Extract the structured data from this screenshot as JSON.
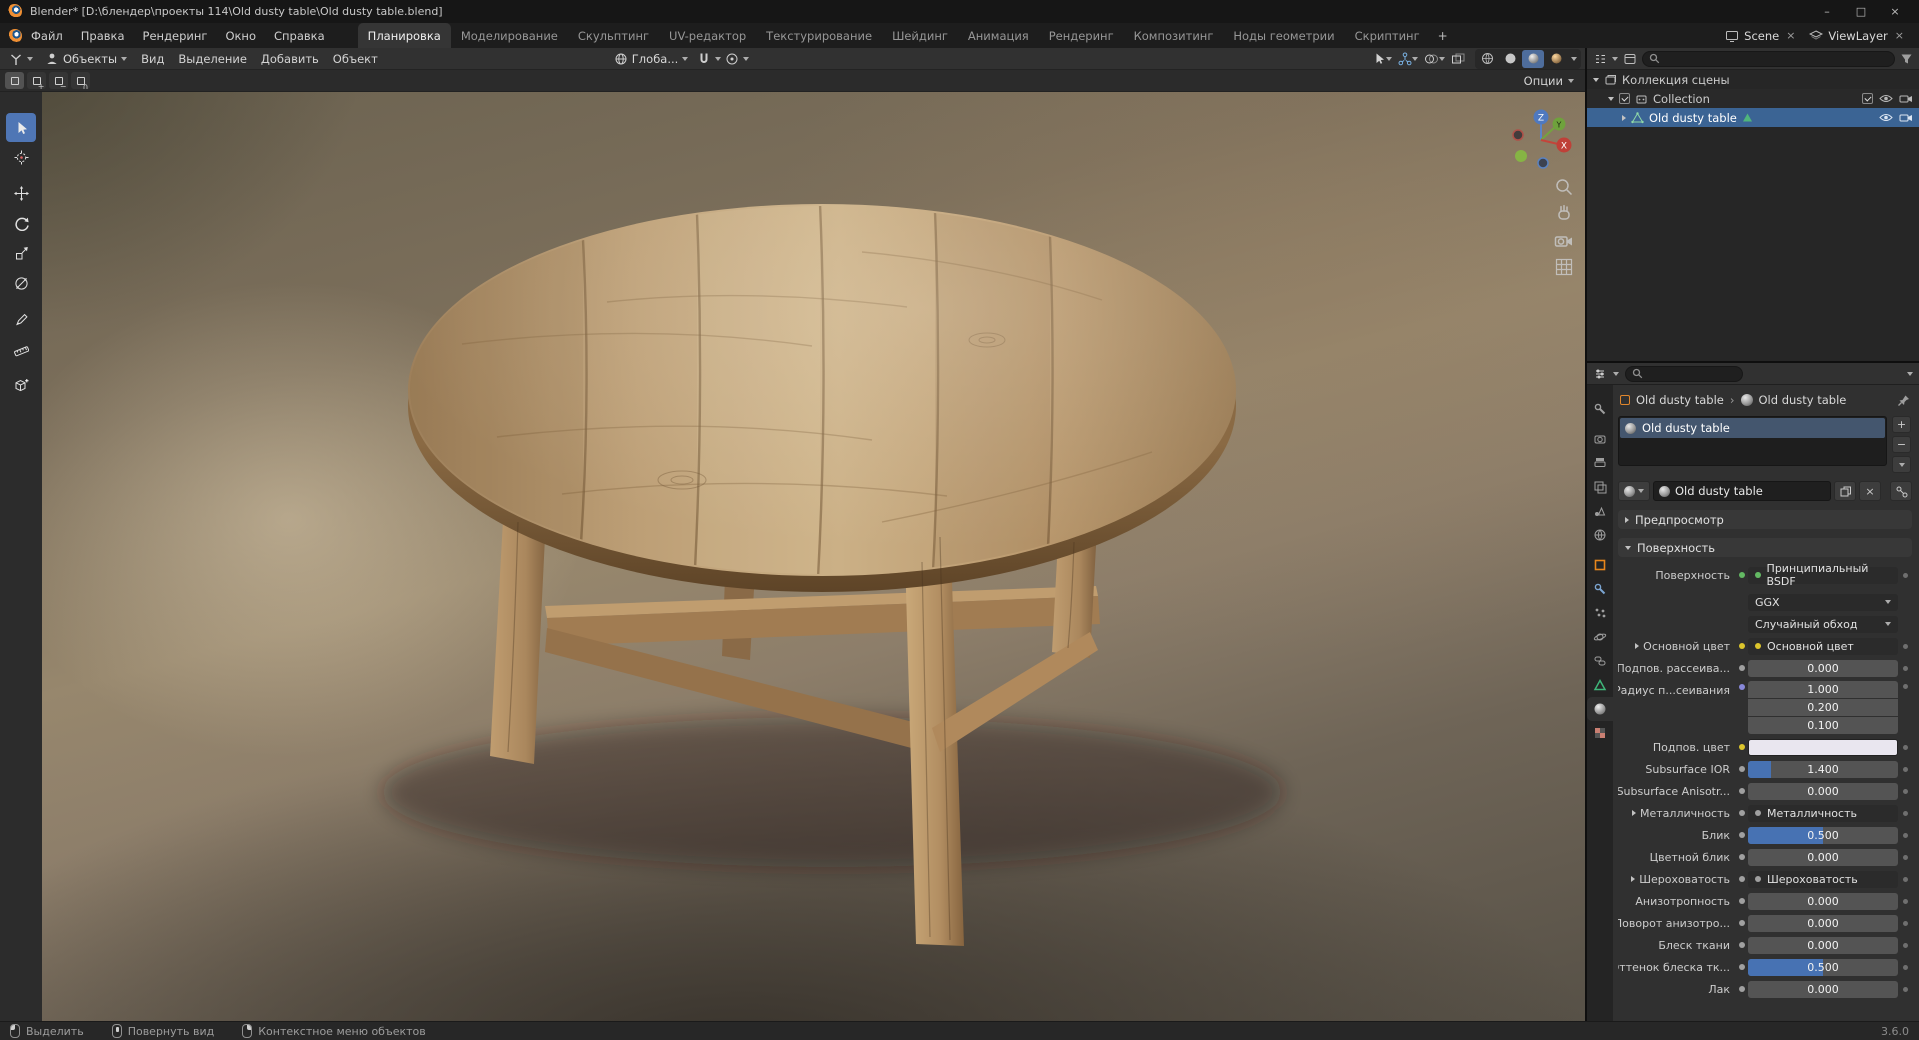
{
  "window": {
    "title": "Blender* [D:\\блендер\\проекты 114\\Old dusty table\\Old dusty table.blend]",
    "controls": {
      "minimize": "–",
      "maximize": "□",
      "close": "×"
    }
  },
  "topbar": {
    "menus": [
      "Файл",
      "Правка",
      "Рендеринг",
      "Окно",
      "Справка"
    ],
    "workspaces": [
      {
        "label": "Планировка",
        "active": true
      },
      {
        "label": "Моделирование"
      },
      {
        "label": "Скульптинг"
      },
      {
        "label": "UV-редактор"
      },
      {
        "label": "Текстурирование"
      },
      {
        "label": "Шейдинг"
      },
      {
        "label": "Анимация"
      },
      {
        "label": "Рендеринг"
      },
      {
        "label": "Композитинг"
      },
      {
        "label": "Ноды геометрии"
      },
      {
        "label": "Скриптинг"
      }
    ],
    "add_workspace": "+",
    "scene": "Scene",
    "view_layer": "ViewLayer"
  },
  "viewport": {
    "header": {
      "mode": "Объекты",
      "menus": [
        "Вид",
        "Выделение",
        "Добавить",
        "Объект"
      ],
      "orientation": "Глоба...",
      "options": "Опции"
    },
    "gizmo_axes": {
      "x": "X",
      "y": "Y",
      "z": "Z"
    }
  },
  "outliner": {
    "rows": [
      {
        "label": "Коллекция сцены"
      },
      {
        "label": "Collection"
      },
      {
        "label": "Old dusty table",
        "selected": true
      }
    ]
  },
  "properties": {
    "breadcrumb": {
      "object": "Old dusty table",
      "material": "Old dusty table"
    },
    "slot": {
      "name": "Old dusty table",
      "add": "+",
      "remove": "−"
    },
    "material_name": "Old dusty table",
    "panels": {
      "preview": "Предпросмотр",
      "surface": "Поверхность"
    },
    "surface_rows": [
      {
        "label": "Поверхность",
        "value": "Принципиальный BSDF",
        "socket": "#63b963"
      },
      {
        "value": "GGX"
      },
      {
        "value": "Случайный обход"
      },
      {
        "label": "Основной цвет",
        "value": "Основной цвет",
        "socket": "#dcc52c"
      },
      {
        "label": "Подпов. рассеива...",
        "value": "0.000",
        "socket": "#a0a0a0"
      },
      {
        "label": "Радиус п...сеивания",
        "values": [
          "1.000",
          "0.200",
          "0.100"
        ],
        "socket": "#8888d9"
      },
      {
        "label": "Подпов. цвет",
        "color": "#e9e6ef",
        "socket": "#dcc52c"
      },
      {
        "label": "Subsurface IOR",
        "value": "1.400",
        "socket": "#a0a0a0"
      },
      {
        "label": "Subsurface Anisotr...",
        "value": "0.000",
        "socket": "#a0a0a0"
      },
      {
        "label": "Металличность",
        "value": "Металличность",
        "socket": "#a0a0a0"
      },
      {
        "label": "Блик",
        "value": "0.500",
        "socket": "#a0a0a0"
      },
      {
        "label": "Цветной блик",
        "value": "0.000",
        "socket": "#a0a0a0"
      },
      {
        "label": "Шероховатость",
        "value": "Шероховатость",
        "socket": "#a0a0a0"
      },
      {
        "label": "Анизотропность",
        "value": "0.000",
        "socket": "#a0a0a0"
      },
      {
        "label": "Поворот анизотро...",
        "value": "0.000",
        "socket": "#a0a0a0"
      },
      {
        "label": "Блеск ткани",
        "value": "0.000",
        "socket": "#a0a0a0"
      },
      {
        "label": "Оттенок блеска тк...",
        "value": "0.500",
        "socket": "#a0a0a0"
      },
      {
        "label": "Лак",
        "value": "0.000",
        "socket": "#a0a0a0"
      }
    ]
  },
  "statusbar": {
    "items": [
      "Выделить",
      "Повернуть вид",
      "Контекстное меню объектов"
    ],
    "version": "3.6.0"
  },
  "colors": {
    "accent": "#4772b3",
    "selection": "#3b6494",
    "slider_fill": "#4772b3",
    "object_orange": "#e8861c",
    "subsurface_color": "#e9e6ef"
  }
}
